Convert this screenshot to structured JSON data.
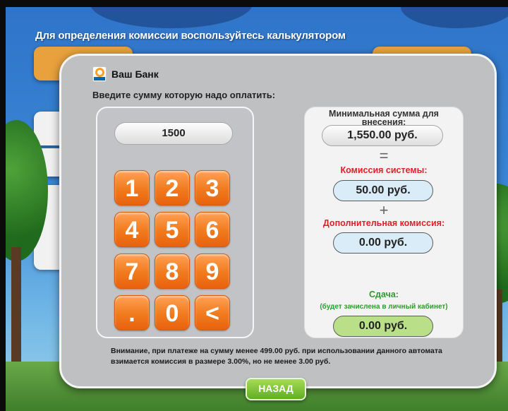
{
  "background": {
    "title": "Для определения комиссии воспользуйтесь калькулятором"
  },
  "modal": {
    "brand_name": "Ваш Банк",
    "prompt": "Введите сумму которую надо оплатить:",
    "amount": "1500",
    "keys": [
      "1",
      "2",
      "3",
      "4",
      "5",
      "6",
      "7",
      "8",
      "9",
      ".",
      "0",
      "<"
    ],
    "min_label": "Минимальная сумма для внесения:",
    "min_value": "1,550.00 руб.",
    "equals": "=",
    "fee_label": "Комиссия системы:",
    "fee_value": "50.00 руб.",
    "plus": "+",
    "extra_label": "Дополнительная комиссия:",
    "extra_value": "0.00 руб.",
    "change_label": "Сдача:",
    "change_note": "(будет зачислена в личный кабинет)",
    "change_value": "0.00 руб.",
    "warning": "Внимание, при платеже на сумму менее 499.00 руб. при использовании данного автомата взимается комиссия в размере 3.00%, но не менее 3.00 руб."
  },
  "back_label": "НАЗАД",
  "colors": {
    "accent_orange": "#f07a1d",
    "fee_red": "#e01f26",
    "change_green": "#2f9a2f",
    "back_green": "#5fae23"
  }
}
